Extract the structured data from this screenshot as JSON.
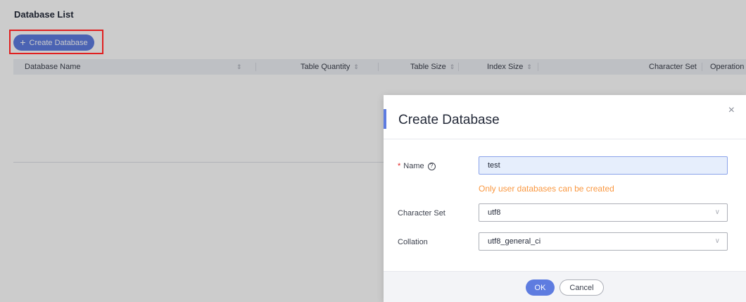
{
  "page": {
    "title": "Database List",
    "create_button_label": "Create Database",
    "create_button_icon": "+"
  },
  "table": {
    "columns": [
      {
        "label": "Database Name",
        "sortable": true
      },
      {
        "label": "Table Quantity",
        "sortable": true
      },
      {
        "label": "Table Size",
        "sortable": true
      },
      {
        "label": "Index Size",
        "sortable": true
      },
      {
        "label": "Character Set",
        "sortable": false
      },
      {
        "label": "Operation",
        "sortable": false
      }
    ],
    "sort_glyph": "⇕"
  },
  "modal": {
    "title": "Create Database",
    "close_glyph": "×",
    "name": {
      "label": "Name",
      "required_mark": "*",
      "help_glyph": "?",
      "value": "test",
      "hint": "Only user databases can be created"
    },
    "character_set": {
      "label": "Character Set",
      "value": "utf8"
    },
    "collation": {
      "label": "Collation",
      "value": "utf8_general_ci"
    },
    "chevron_glyph": "∨",
    "ok_label": "OK",
    "cancel_label": "Cancel"
  },
  "colors": {
    "accent": "#5e7ce0",
    "hint": "#fa9841",
    "highlight_border": "#e02020"
  }
}
